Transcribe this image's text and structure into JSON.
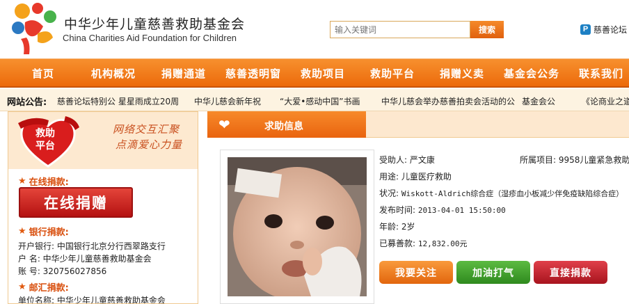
{
  "header": {
    "org_name_cn": "中华少年儿童慈善救助基金会",
    "org_name_en": "China Charities Aid Foundation for Children",
    "search_placeholder": "输入关键词",
    "search_button": "搜索",
    "forum_link": "慈善论坛"
  },
  "nav": [
    "首页",
    "机构概况",
    "捐赠通道",
    "慈善透明窗",
    "救助项目",
    "救助平台",
    "捐赠义卖",
    "基金会公务",
    "联系我们"
  ],
  "notice": {
    "label": "网站公告:",
    "items": [
      "慈善论坛特别公 星星雨成立20周",
      "中华儿慈会新年祝",
      "“大爱•感动中国”书画",
      "中华儿慈会举办慈善拍卖会活动的公",
      "基金会公",
      "《论商业之道"
    ]
  },
  "left_panel": {
    "banner_title_line1": "救助",
    "banner_title_line2": "平台",
    "slogan_line1": "网络交互汇聚",
    "slogan_line2": "点滴爱心力量",
    "online_heading": "在线捐款:",
    "online_button": "在线捐赠",
    "bank_heading": "银行捐款:",
    "bank_lines": [
      "开户银行: 中国银行北京分行西翠路支行",
      "户  名: 中华少年儿童慈善救助基金会",
      "账  号: 320756027856"
    ],
    "post_heading": "邮汇捐款:",
    "post_lines": [
      "单位名称: 中华少年儿童慈善救助基金会"
    ]
  },
  "right_panel": {
    "section_title": "求助信息",
    "recipient": "受助人: 严文康",
    "project": "所属项目: 9958儿童紧急救助",
    "purpose": "用途: 儿童医疗救助",
    "condition_label": "状况: ",
    "condition_value": "Wiskott-Aldrich综合症（湿疹血小板减少伴免疫缺陷综合症）",
    "published_label": "发布时间: ",
    "published_value": "2013-04-01 15:50:00",
    "age": "年龄: 2岁",
    "raised_label": "已募善款: ",
    "raised_value": "12,832.00元",
    "buttons": [
      "我要关注",
      "加油打气",
      "直接捐款"
    ]
  },
  "colors": {
    "nav_orange": "#ec6a0b",
    "follow_btn": "#f07d1c",
    "cheer_btn": "#3f9a2c",
    "donate_btn": "#c01f2a"
  }
}
